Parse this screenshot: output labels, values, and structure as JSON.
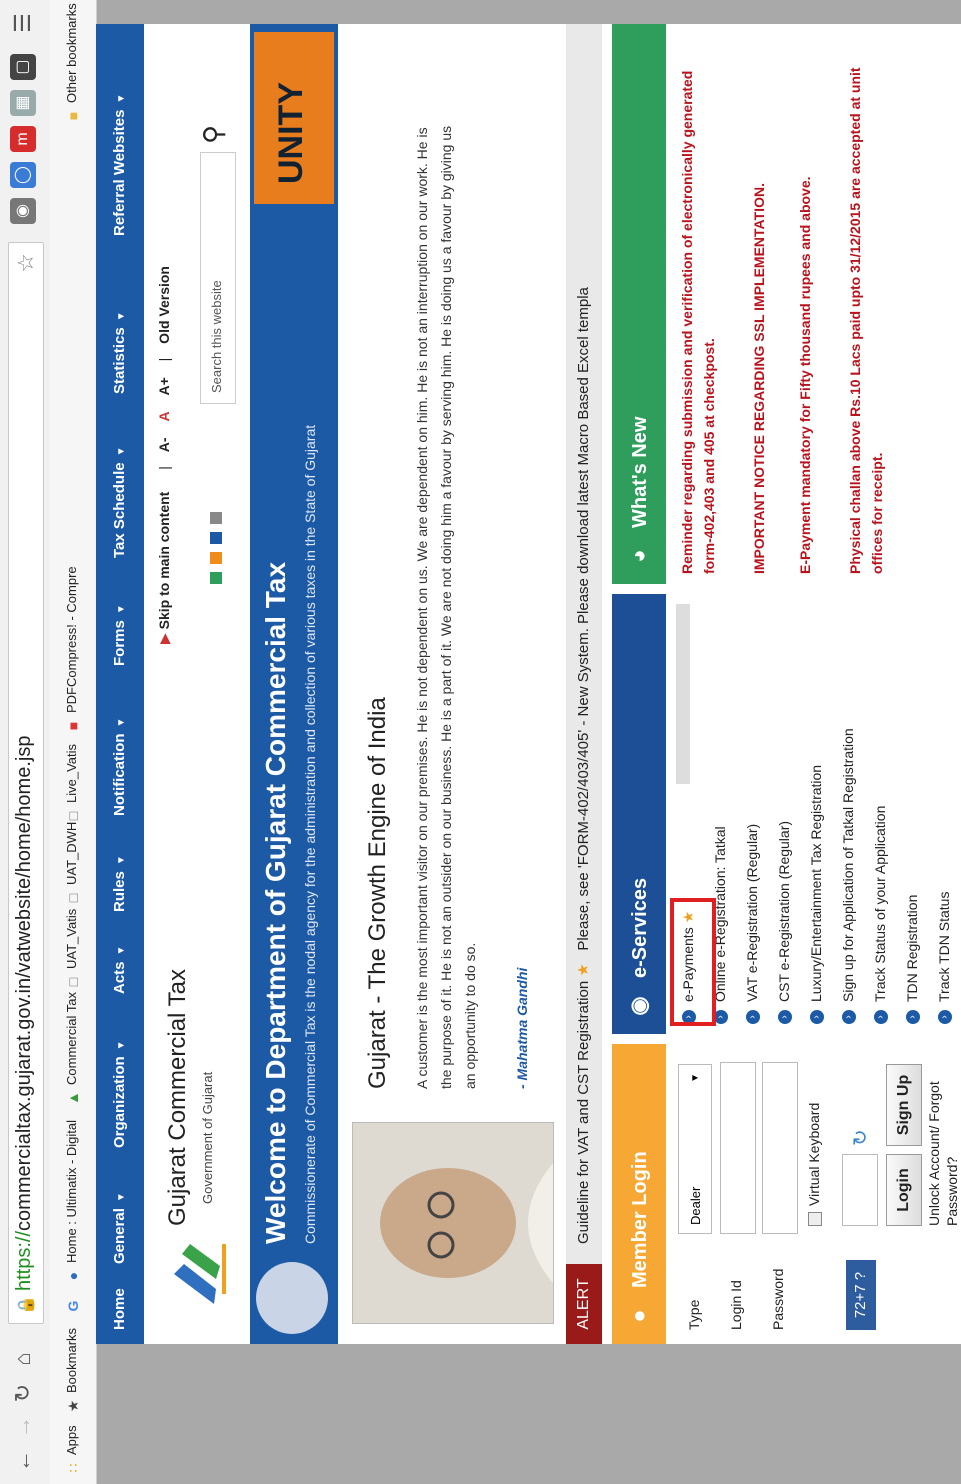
{
  "browser": {
    "url_scheme": "https://",
    "url_rest": "commercialtax.gujarat.gov.in/vatwebsite/home/home.jsp",
    "bookmarks": [
      "Apps",
      "Bookmarks",
      "Home : Ultimatix - Digital",
      "Commercial Tax",
      "UAT_Vatis",
      "UAT_DWH",
      "Live_Vatis",
      "PDFCompress! - Compre"
    ],
    "other_bookmarks": "Other bookmarks"
  },
  "nav": [
    "Home",
    "General",
    "Organization",
    "Acts",
    "Rules",
    "Notification",
    "Forms",
    "Tax Schedule",
    "Statistics",
    "Referral Websites"
  ],
  "header": {
    "title": "Gujarat Commercial Tax",
    "subtitle": "Government of Gujarat",
    "skip": "Skip to main content",
    "font_small": "A-",
    "font_normal": "A",
    "font_large": "A+",
    "old_version": "Old Version",
    "search_placeholder": "Search this website"
  },
  "banner": {
    "title": "Welcome to Department of Gujarat Commercial Tax",
    "subtitle": "Commissionerate of Commercial Tax is the nodal agency for the administration and collection of various taxes in the State of Gujarat"
  },
  "quote": {
    "title": "Gujarat - The Growth Engine of India",
    "text": "A customer is the most important visitor on our premises. He is not dependent on us. We are dependent on him. He is not an interruption on our work. He is the purpose of it. He is not an outsider on our business. He is a part of it. We are not doing him a favour by serving him. He is doing us a favour by giving us an opportunity to do so.",
    "author": "- Mahatma Gandhi"
  },
  "alert": {
    "tag": "ALERT",
    "text": "Guideline for VAT and CST Registration",
    "text2": "Please, see 'FORM-402/403/405' - New System. Please download latest Macro Based Excel templa"
  },
  "login": {
    "heading": "Member Login",
    "type_label": "Type",
    "type_value": "Dealer",
    "login_label": "Login Id",
    "password_label": "Password",
    "virtual_keyboard": "Virtual Keyboard",
    "captcha": "72+7 ?",
    "login_btn": "Login",
    "signup_btn": "Sign Up",
    "unlock": "Unlock Account/ Forgot",
    "password_link": "Password?"
  },
  "eservices": {
    "heading": "e-Services",
    "items": [
      "e-Payments",
      "Online e-Registration: Tatkal",
      "VAT e-Registration (Regular)",
      "CST e-Registration (Regular)",
      "Luxury/Entertainment Tax Registration",
      "Sign up for Application of Tatkal Registration",
      "Track Status of your Application",
      "TDN Registration",
      "Track TDN Status"
    ]
  },
  "whats_new": {
    "heading": "What's New",
    "items": [
      "Reminder regarding submission and verification of electronically generated form-402,403 and 405 at checkpost.",
      "IMPORTANT NOTICE REGARDING SSL IMPLEMENTATION.",
      "E-Payment mandatory for Fifty thousand rupees and above.",
      "Physical challan above Rs.10 Lacs paid upto 31/12/2015 are accepted at unit offices for receipt."
    ]
  },
  "colors": {
    "primary": "#1d5aa6",
    "login": "#f7a733",
    "eservices": "#1d4f97",
    "whatsnew": "#2f9e5d",
    "alert": "#9a1a1a",
    "news": "#b8141e"
  }
}
